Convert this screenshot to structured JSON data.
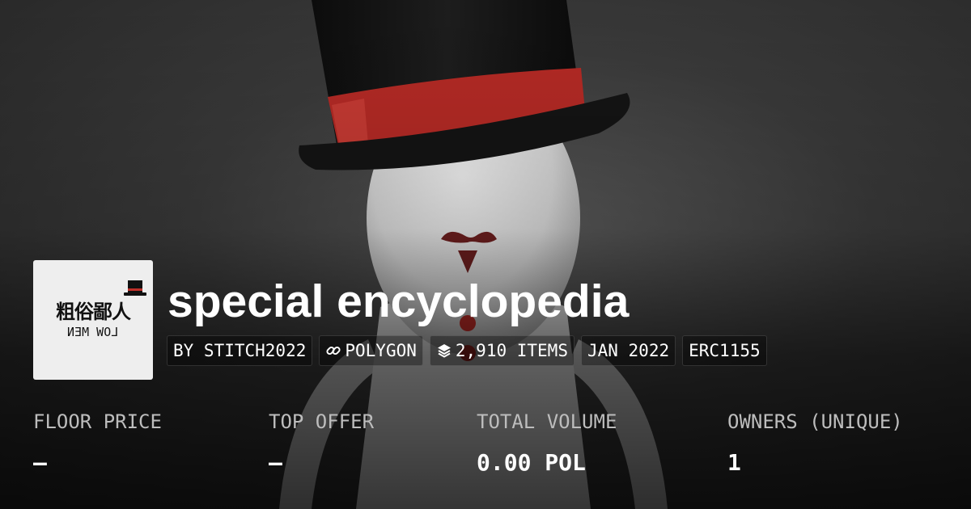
{
  "collection": {
    "logo_text_cn": "粗俗鄙人",
    "logo_text_en": "LOW MEN",
    "name": "special encyclopedia"
  },
  "tags": {
    "creator": "BY STITCH2022",
    "chain": "POLYGON",
    "chain_icon": "link-icon",
    "items": "2,910 ITEMS",
    "items_icon": "layers-icon",
    "date": "JAN 2022",
    "standard": "ERC1155"
  },
  "stats": [
    {
      "label": "FLOOR PRICE",
      "value": "–"
    },
    {
      "label": "TOP OFFER",
      "value": "–"
    },
    {
      "label": "TOTAL VOLUME",
      "value": "0.00 POL"
    },
    {
      "label": "OWNERS (UNIQUE)",
      "value": "1"
    }
  ],
  "colors": {
    "hat_band": "#b52a25",
    "text": "#ffffff",
    "label_text": "#bdbdbd"
  }
}
